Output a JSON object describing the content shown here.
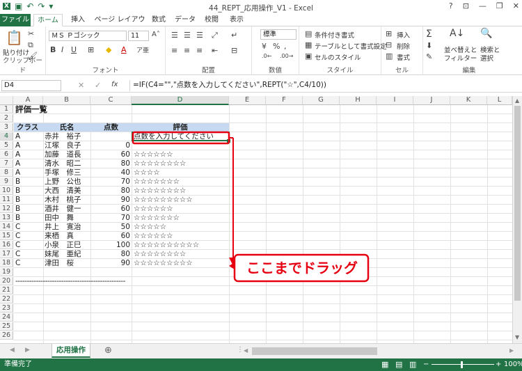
{
  "window": {
    "title": "44_REPT_応用操作_V1 - Excel",
    "help": "?"
  },
  "ribbon_tabs": [
    "ファイル",
    "ホーム",
    "挿入",
    "ページ レイアウト",
    "数式",
    "データ",
    "校閲",
    "表示"
  ],
  "ribbon": {
    "clipboard": {
      "paste": "貼り付け",
      "label": "クリップボード"
    },
    "font": {
      "name": "ＭＳ Ｐゴシック",
      "size": "11",
      "label": "フォント"
    },
    "alignment": {
      "label": "配置"
    },
    "number": {
      "format": "標準",
      "label": "数値"
    },
    "styles": {
      "conditional": "条件付き書式",
      "table": "テーブルとして書式設定",
      "cell": "セルのスタイル",
      "label": "スタイル"
    },
    "cells": {
      "insert": "挿入",
      "delete": "削除",
      "format": "書式",
      "label": "セル"
    },
    "editing": {
      "sort": "並べ替えと",
      "filter": "フィルター",
      "find": "検索と",
      "select": "選択",
      "label": "編集"
    }
  },
  "formula_bar": {
    "name_box": "D4",
    "fx": "fx",
    "formula": "=IF(C4=\"\",\"点数を入力してください\",REPT(\"☆\",C4/10))"
  },
  "columns": [
    "A",
    "B",
    "C",
    "D",
    "E",
    "F",
    "G",
    "H",
    "I",
    "J",
    "K",
    "L"
  ],
  "rows": [
    "1",
    "2",
    "3",
    "4",
    "5",
    "6",
    "7",
    "8",
    "9",
    "10",
    "11",
    "12",
    "13",
    "14",
    "15",
    "16",
    "17",
    "18",
    "19",
    "20",
    "21",
    "22",
    "23",
    "24",
    "25",
    "26"
  ],
  "sheet": {
    "title": "評価一覧",
    "headers": {
      "class": "クラス",
      "name": "氏名",
      "score": "点数",
      "rating": "評価"
    },
    "records": [
      {
        "class": "A",
        "name": "赤井　裕子",
        "score": "",
        "rating": "点数を入力してください"
      },
      {
        "class": "A",
        "name": "江塚　良子",
        "score": "0",
        "rating": ""
      },
      {
        "class": "A",
        "name": "加藤　道長",
        "score": "60",
        "rating": "☆☆☆☆☆☆"
      },
      {
        "class": "A",
        "name": "清水　昭二",
        "score": "80",
        "rating": "☆☆☆☆☆☆☆☆"
      },
      {
        "class": "A",
        "name": "手塚　修三",
        "score": "40",
        "rating": "☆☆☆☆"
      },
      {
        "class": "B",
        "name": "上野　公也",
        "score": "70",
        "rating": "☆☆☆☆☆☆☆"
      },
      {
        "class": "B",
        "name": "大西　清美",
        "score": "80",
        "rating": "☆☆☆☆☆☆☆☆"
      },
      {
        "class": "B",
        "name": "木村　桃子",
        "score": "90",
        "rating": "☆☆☆☆☆☆☆☆☆"
      },
      {
        "class": "B",
        "name": "酒井　健一",
        "score": "60",
        "rating": "☆☆☆☆☆☆"
      },
      {
        "class": "B",
        "name": "田中　舞",
        "score": "70",
        "rating": "☆☆☆☆☆☆☆"
      },
      {
        "class": "C",
        "name": "井上　寛治",
        "score": "50",
        "rating": "☆☆☆☆☆"
      },
      {
        "class": "C",
        "name": "来栖　真",
        "score": "60",
        "rating": "☆☆☆☆☆☆"
      },
      {
        "class": "C",
        "name": "小泉　正巳",
        "score": "100",
        "rating": "☆☆☆☆☆☆☆☆☆☆"
      },
      {
        "class": "C",
        "name": "妹尾　亜紀",
        "score": "80",
        "rating": "☆☆☆☆☆☆☆☆"
      },
      {
        "class": "C",
        "name": "津田　桜",
        "score": "90",
        "rating": "☆☆☆☆☆☆☆☆☆"
      }
    ],
    "separator": "------------------------------------------------"
  },
  "callout": {
    "text": "ここまでドラッグ",
    "color": "#e60012"
  },
  "sheet_tabs": {
    "active": "応用操作",
    "add": "⊕"
  },
  "status": {
    "ready": "準備完了",
    "zoom": "100%"
  },
  "colors": {
    "excel_green": "#217346",
    "header_fill": "#c6d9f0"
  }
}
